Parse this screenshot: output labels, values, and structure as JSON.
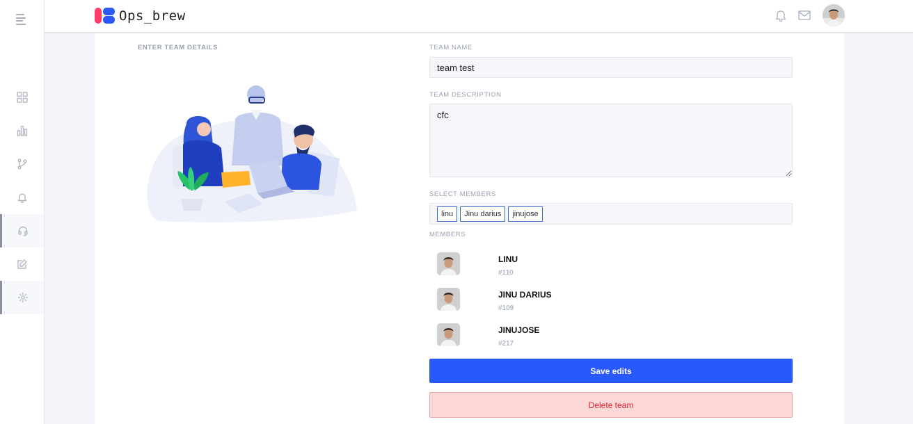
{
  "app": {
    "name": "Ops_brew"
  },
  "sidebar": {
    "items": [
      {
        "name": "dashboard",
        "icon": "grid-icon",
        "active": false
      },
      {
        "name": "analytics",
        "icon": "bar-chart-icon",
        "active": false
      },
      {
        "name": "git",
        "icon": "git-branch-icon",
        "active": false
      },
      {
        "name": "notifications",
        "icon": "bell-icon",
        "active": false
      },
      {
        "name": "support",
        "icon": "headset-icon",
        "active": true
      },
      {
        "name": "edit",
        "icon": "edit-icon",
        "active": false
      },
      {
        "name": "settings",
        "icon": "gear-icon",
        "active": true
      }
    ]
  },
  "header": {
    "icons": [
      "bell-icon",
      "mail-icon",
      "user-avatar"
    ]
  },
  "form": {
    "section_title": "ENTER TEAM DETAILS",
    "team_name_label": "TEAM NAME",
    "team_name_value": "team test",
    "team_description_label": "TEAM DESCRIPTION",
    "team_description_value": "cfc",
    "select_members_label": "SELECT MEMBERS",
    "selected_tags": [
      "linu",
      "Jinu darius",
      "jinujose"
    ],
    "members_label": "MEMBERS",
    "members": [
      {
        "name": "LINU",
        "id": "#110"
      },
      {
        "name": "JINU DARIUS",
        "id": "#109"
      },
      {
        "name": "JINUJOSE",
        "id": "#217"
      }
    ],
    "save_label": "Save edits",
    "delete_label": "Delete team"
  },
  "colors": {
    "primary": "#2a59fb",
    "danger_text": "#e0262f",
    "danger_bg": "#fbd7d8",
    "logo_pink": "#ff3d6b",
    "logo_blue": "#2a59f5"
  }
}
